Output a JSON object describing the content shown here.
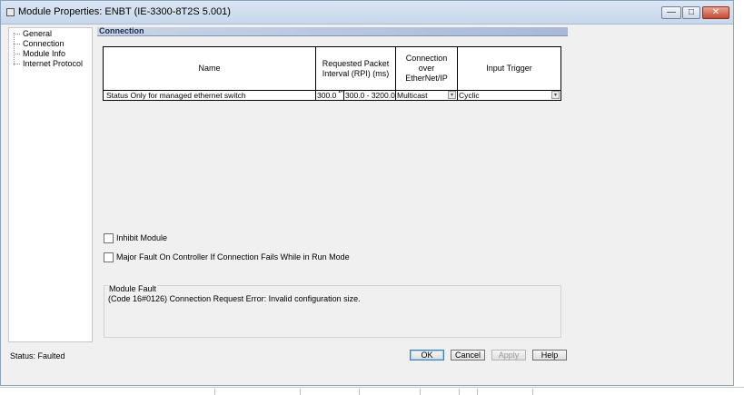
{
  "window": {
    "title": "Module Properties: ENBT (IE-3300-8T2S 5.001)",
    "controls": {
      "minimize": "—",
      "maximize": "□",
      "close": "✕"
    }
  },
  "nav": {
    "items": [
      "General",
      "Connection",
      "Module Info",
      "Internet Protocol"
    ]
  },
  "section": {
    "title": "Connection"
  },
  "connection_table": {
    "headers": [
      "Name",
      "Requested Packet Interval (RPI) (ms)",
      "Connection over EtherNet/IP",
      "Input Trigger"
    ],
    "row": {
      "name": "Status Only for managed ethernet switch",
      "rpi": "300.0",
      "rpi_range": "300.0 - 3200.0",
      "connection_type": "Multicast",
      "input_trigger": "Cyclic"
    }
  },
  "options": {
    "inhibit_module": "Inhibit Module",
    "major_fault": "Major Fault On Controller If Connection Fails While in Run Mode"
  },
  "module_fault": {
    "title": "Module Fault",
    "text": "(Code 16#0126) Connection Request Error: Invalid configuration size."
  },
  "status": "Status:  Faulted",
  "buttons": {
    "ok": "OK",
    "cancel": "Cancel",
    "apply": "Apply",
    "help": "Help"
  },
  "icons": {
    "dropdown": "▾",
    "spin": "▴▾"
  }
}
